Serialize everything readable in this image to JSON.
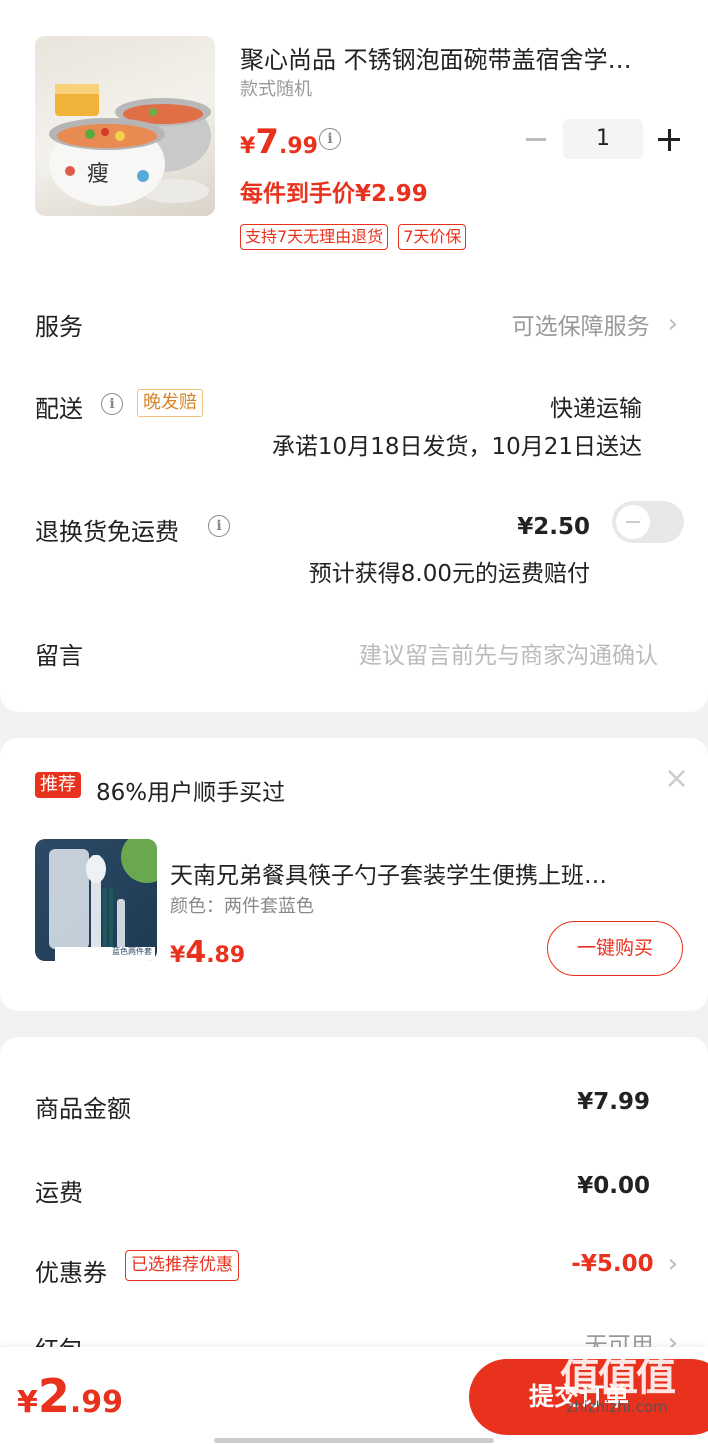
{
  "product": {
    "title": "聚心尚品 不锈钢泡面碗带盖宿舍学…",
    "spec": "款式随机",
    "price_symbol": "¥",
    "price_int": "7",
    "price_dec": ".99",
    "per_item_price": "每件到手价¥2.99",
    "quantity": "1",
    "tags": [
      "支持7天无理由退货",
      "7天价保"
    ],
    "thumb_text": "瘦"
  },
  "service": {
    "label": "服务",
    "value": "可选保障服务"
  },
  "delivery": {
    "label": "配送",
    "badge": "晚发赔",
    "method": "快递运输",
    "promise": "承诺10月18日发货，10月21日送达"
  },
  "return_shipping": {
    "label": "退换货免运费",
    "price": "¥2.50",
    "note": "预计获得8.00元的运费赔付",
    "enabled": false
  },
  "message": {
    "label": "留言",
    "placeholder": "建议留言前先与商家沟通确认"
  },
  "recommend": {
    "badge": "推荐",
    "headline": "86%用户顺手买过",
    "close": "×",
    "item_title": "天南兄弟餐具筷子勺子套装学生便携上班…",
    "item_spec": "颜色：两件套蓝色",
    "price_symbol": "¥",
    "price_int": "4",
    "price_dec": ".89",
    "buy_label": "一键购买",
    "thumb_caption": "蓝色两件套"
  },
  "summary": {
    "goods_label": "商品金额",
    "goods_value": "¥7.99",
    "shipping_label": "运费",
    "shipping_value": "¥0.00",
    "coupon_label": "优惠券",
    "coupon_tag": "已选推荐优惠",
    "coupon_value": "-¥5.00",
    "redpacket_label": "红包",
    "redpacket_value": "无可用"
  },
  "bottom": {
    "price_symbol": "¥",
    "price_int": "2",
    "price_dec": ".99",
    "submit_label": "提交订单",
    "watermark_main": "值值值",
    "watermark_sub": "zhizhizhi.com"
  }
}
